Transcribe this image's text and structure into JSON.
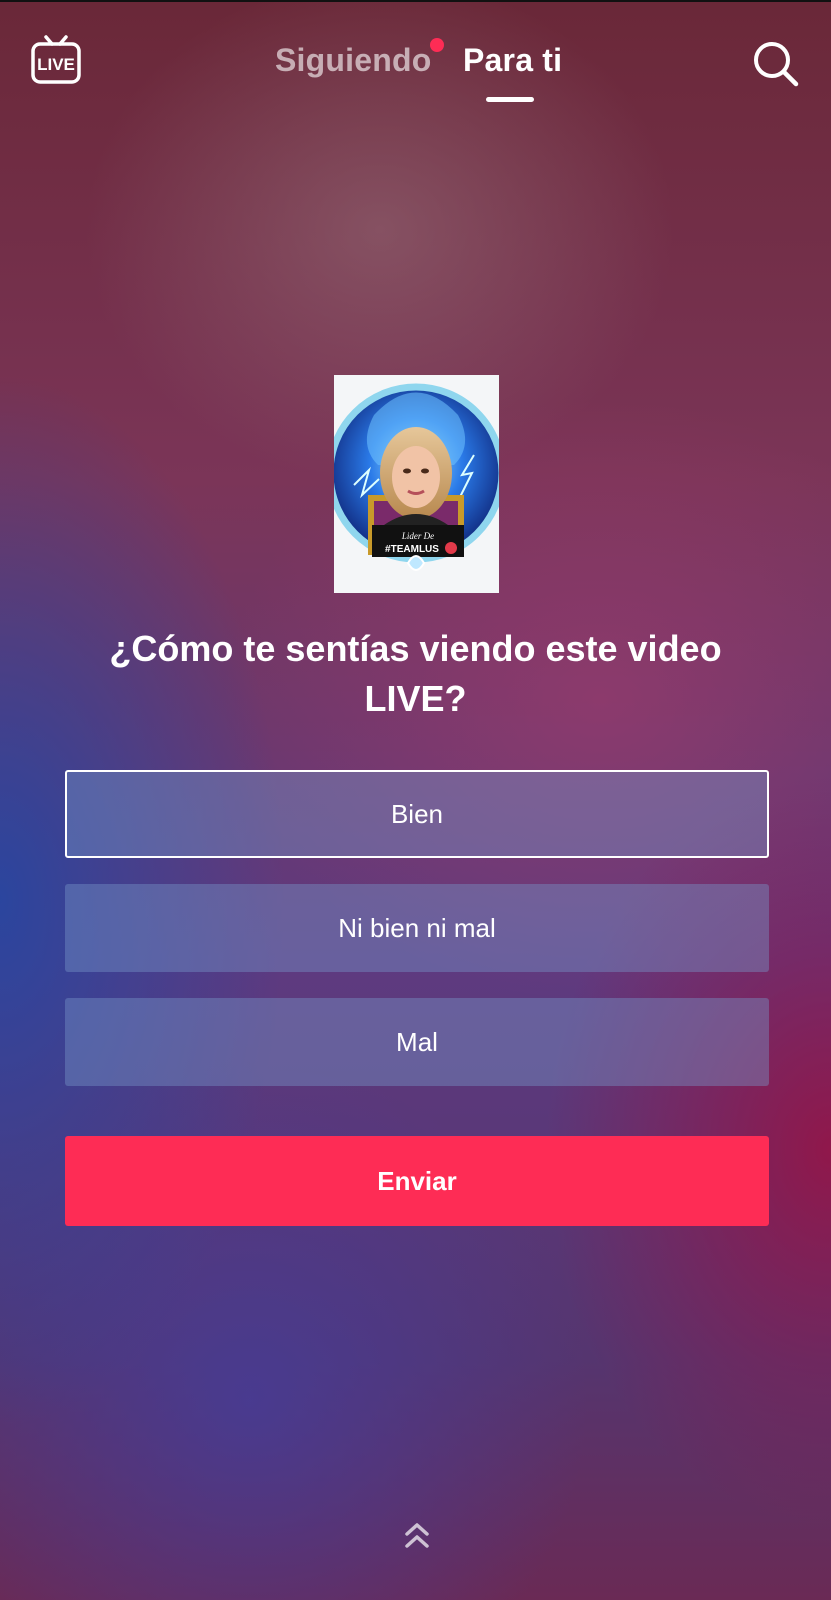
{
  "header": {
    "live_icon": "live-tv-icon",
    "live_label": "LIVE",
    "tabs": [
      {
        "label": "Siguiendo",
        "has_notification": true
      },
      {
        "label": "Para ti",
        "active": true
      }
    ],
    "search_icon": "search-icon"
  },
  "survey": {
    "avatar_caption_1": "Lider De",
    "avatar_caption_2": "#TEAMLUS",
    "question": "¿Cómo te sentías viendo este video LIVE?",
    "options": [
      {
        "label": "Bien",
        "selected": true
      },
      {
        "label": "Ni bien ni mal",
        "selected": false
      },
      {
        "label": "Mal",
        "selected": false
      }
    ],
    "submit_label": "Enviar"
  },
  "footer": {
    "swipe_icon": "double-chevron-up-icon"
  },
  "colors": {
    "accent": "#fe2c55",
    "notification_dot": "#fe2c55"
  }
}
